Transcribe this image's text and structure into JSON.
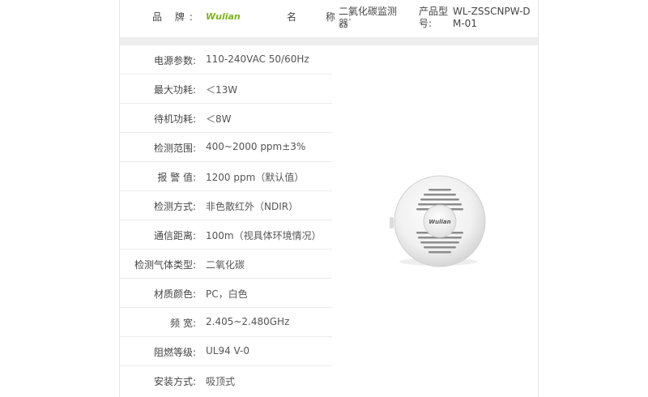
{
  "header": {
    "brand_label": "品 牌:",
    "brand_logo": "Wulian",
    "name_label": "名 称:",
    "name_value": "二氧化碳监测器",
    "model_label": "产品型号:",
    "model_value": "WL-ZSSCNPW-DM-01"
  },
  "specs": [
    {
      "label": "电源参数:",
      "value": "110-240VAC 50/60Hz"
    },
    {
      "label": "最大功耗:",
      "value": "＜13W"
    },
    {
      "label": "待机功耗:",
      "value": "＜8W"
    },
    {
      "label": "检测范围:",
      "value": "400~2000 ppm±3%"
    },
    {
      "label": "报 警 值:",
      "value": "1200 ppm（默认值）"
    },
    {
      "label": "检测方式:",
      "value": "非色散红外（NDIR）"
    },
    {
      "label": "通信距离:",
      "value": "100m（视具体环境情况）"
    },
    {
      "label": "检测气体类型:",
      "value": "二氧化碳"
    },
    {
      "label": "材质颜色:",
      "value": "PC，白色"
    },
    {
      "label": "频 宽:",
      "value": "2.405~2.480GHz"
    },
    {
      "label": "阻燃等级:",
      "value": "UL94 V-0"
    },
    {
      "label": "安装方式:",
      "value": "吸顶式"
    }
  ],
  "product_image": {
    "logo_text": "Wulian",
    "color_body": "#f2f2f2",
    "color_accent": "#7cb518"
  }
}
